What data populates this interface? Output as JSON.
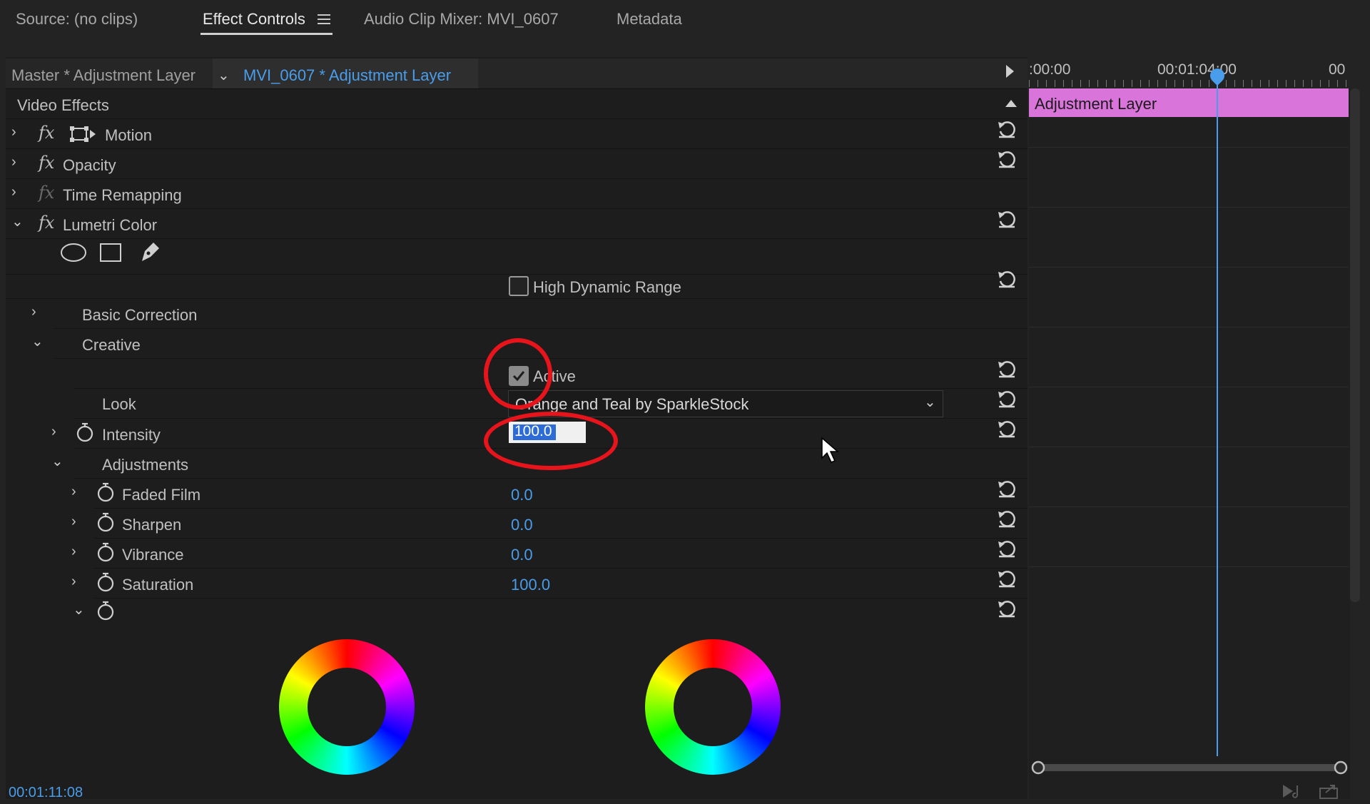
{
  "tabs": [
    {
      "label": "Source: (no clips)"
    },
    {
      "label": "Effect Controls"
    },
    {
      "label": "Audio Clip Mixer: MVI_0607"
    },
    {
      "label": "Metadata"
    }
  ],
  "clip": {
    "master_label": "Master * Adjustment Layer",
    "active_label": "MVI_0607 * Adjustment Layer"
  },
  "timeline": {
    "ruler_start": ":00:00",
    "ruler_mid": "00:01:04:00",
    "ruler_end": "00",
    "clip_label": "Adjustment Layer"
  },
  "section": {
    "title": "Video Effects"
  },
  "effects": {
    "motion": "Motion",
    "opacity": "Opacity",
    "time_remapping": "Time Remapping",
    "lumetri": "Lumetri Color"
  },
  "lumetri": {
    "hdr_label": "High Dynamic Range",
    "hdr_checked": false,
    "basic_correction": "Basic Correction",
    "creative": "Creative",
    "active_label": "Active",
    "active_checked": true,
    "look_label": "Look",
    "look_value": "Orange and Teal by SparkleStock",
    "intensity_label": "Intensity",
    "intensity_value": "100.0",
    "adjustments_label": "Adjustments",
    "params": [
      {
        "label": "Faded Film",
        "value": "0.0"
      },
      {
        "label": "Sharpen",
        "value": "0.0"
      },
      {
        "label": "Vibrance",
        "value": "0.0"
      },
      {
        "label": "Saturation",
        "value": "100.0"
      }
    ]
  },
  "footer": {
    "timecode": "00:01:11:08"
  },
  "colors": {
    "accent": "#4a9dea",
    "clip": "#d974da",
    "annotation": "#e8141b"
  }
}
